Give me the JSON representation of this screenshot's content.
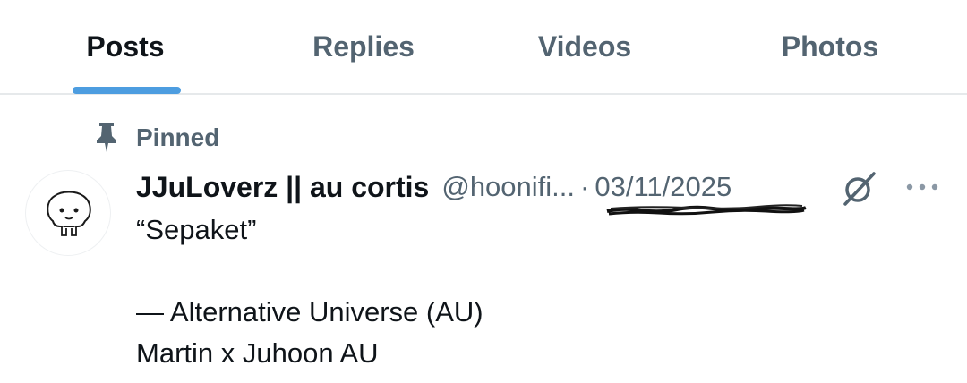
{
  "tabs": [
    {
      "label": "Posts",
      "active": true
    },
    {
      "label": "Replies",
      "active": false
    },
    {
      "label": "Videos",
      "active": false
    },
    {
      "label": "Photos",
      "active": false
    }
  ],
  "pinned": {
    "label": "Pinned",
    "icon": "pin-icon"
  },
  "tweet": {
    "display_name": "JJuLoverz || au cortis",
    "handle": "@hoonifi...",
    "separator": "·",
    "date": "03/11/2025",
    "lines": [
      "“Sepaket”",
      "",
      "— Alternative Universe (AU)",
      "Martin x Juhoon AU"
    ]
  },
  "icons": {
    "grok": "grok-icon",
    "more": "more-icon"
  },
  "colors": {
    "accent": "#4d9de0",
    "secondary_text": "#536471",
    "primary_text": "#0f1419",
    "divider": "#e6e9eb"
  }
}
